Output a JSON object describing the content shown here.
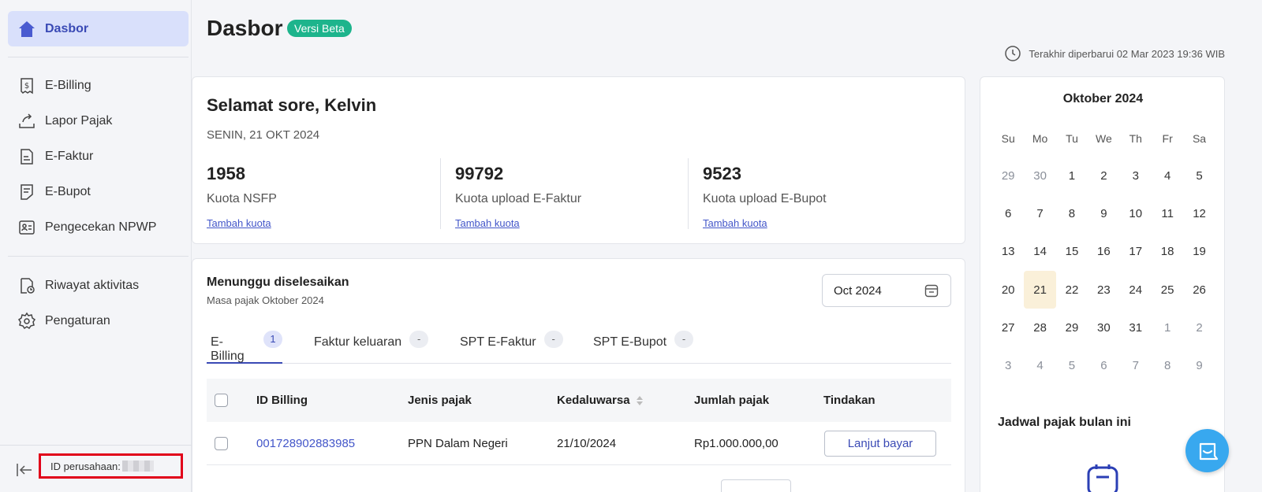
{
  "sidebar": {
    "items": [
      {
        "label": "Dasbor",
        "icon": "home-icon"
      },
      {
        "label": "E-Billing",
        "icon": "billing-icon"
      },
      {
        "label": "Lapor Pajak",
        "icon": "upload-report-icon"
      },
      {
        "label": "E-Faktur",
        "icon": "document-icon"
      },
      {
        "label": "E-Bupot",
        "icon": "receipt-icon"
      },
      {
        "label": "Pengecekan NPWP",
        "icon": "id-card-icon"
      },
      {
        "label": "Riwayat aktivitas",
        "icon": "history-icon"
      },
      {
        "label": "Pengaturan",
        "icon": "gear-icon"
      }
    ],
    "company_id_label": "ID perusahaan:"
  },
  "header": {
    "title": "Dasbor",
    "badge": "Versi Beta",
    "last_updated": "Terakhir diperbarui 02 Mar 2023 19:36 WIB"
  },
  "greeting": {
    "text": "Selamat sore, Kelvin",
    "date": "SENIN, 21 OKT 2024",
    "quotas": [
      {
        "value": "1958",
        "label": "Kuota NSFP",
        "link": "Tambah kuota"
      },
      {
        "value": "99792",
        "label": "Kuota upload E-Faktur",
        "link": "Tambah kuota"
      },
      {
        "value": "9523",
        "label": "Kuota upload E-Bupot",
        "link": "Tambah kuota"
      }
    ]
  },
  "pending": {
    "title": "Menunggu diselesaikan",
    "subtitle": "Masa pajak Oktober 2024",
    "month_picker": "Oct 2024",
    "tabs": [
      {
        "label": "E-Billing",
        "count": "1"
      },
      {
        "label": "Faktur keluaran",
        "count": "-"
      },
      {
        "label": "SPT E-Faktur",
        "count": "-"
      },
      {
        "label": "SPT E-Bupot",
        "count": "-"
      }
    ],
    "columns": [
      "ID Billing",
      "Jenis pajak",
      "Kedaluwarsa",
      "Jumlah pajak",
      "Tindakan"
    ],
    "rows": [
      {
        "id": "001728902883985",
        "type": "PPN Dalam Negeri",
        "expiry": "21/10/2024",
        "amount": "Rp1.000.000,00",
        "action": "Lanjut bayar"
      }
    ]
  },
  "calendar": {
    "title": "Oktober 2024",
    "weekdays": [
      "Su",
      "Mo",
      "Tu",
      "We",
      "Th",
      "Fr",
      "Sa"
    ],
    "weeks": [
      [
        "29",
        "30",
        "1",
        "2",
        "3",
        "4",
        "5"
      ],
      [
        "6",
        "7",
        "8",
        "9",
        "10",
        "11",
        "12"
      ],
      [
        "13",
        "14",
        "15",
        "16",
        "17",
        "18",
        "19"
      ],
      [
        "20",
        "21",
        "22",
        "23",
        "24",
        "25",
        "26"
      ],
      [
        "27",
        "28",
        "29",
        "30",
        "31",
        "1",
        "2"
      ],
      [
        "3",
        "4",
        "5",
        "6",
        "7",
        "8",
        "9"
      ]
    ],
    "today": "21",
    "schedule_title": "Jadwal pajak bulan ini"
  },
  "colors": {
    "accent": "#3a4ab5",
    "badge": "#1db48c",
    "chat": "#38a8ef",
    "highlight_box": "#e1001a"
  }
}
